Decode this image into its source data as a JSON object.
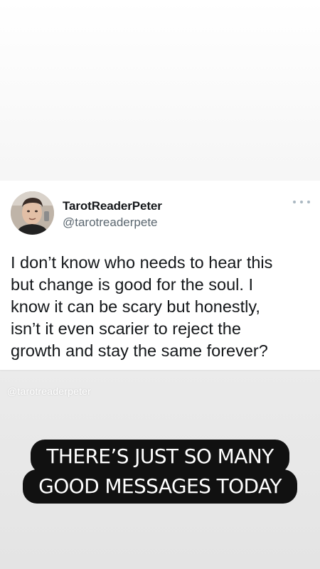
{
  "tweet": {
    "author_name": "TarotReaderPeter",
    "author_handle": "@tarotreaderpete",
    "text_lines": [
      "I don’t know who needs to hear this",
      "but change is good for the soul. I",
      "know it can be scary but honestly,",
      "isn’t it even scarier to reject the",
      "growth and stay the same forever?"
    ],
    "avatar_icon": "profile-photo"
  },
  "watermark": "@tarotreaderpeter",
  "caption": {
    "lines": [
      "THERE’S JUST SO MANY",
      "GOOD MESSAGES TODAY"
    ]
  },
  "colors": {
    "caption_background": "#111111",
    "caption_text": "#ffffff",
    "card_background": "#ffffff",
    "handle_text": "#5b6770"
  }
}
